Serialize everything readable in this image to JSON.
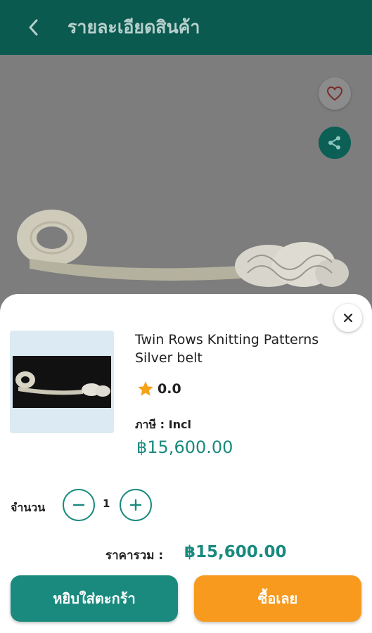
{
  "header": {
    "title": "รายละเอียดสินค้า",
    "back_icon": "chevron-left-icon"
  },
  "product_area": {
    "favorite_icon": "heart-icon",
    "share_icon": "share-icon"
  },
  "sheet": {
    "product_name": "Twin Rows Knitting Patterns Silver belt",
    "rating": "0.0",
    "tax_label": "ภาษี :",
    "tax_value": "Incl",
    "price": "฿15,600.00",
    "quantity_label": "จำนวน",
    "quantity": "1",
    "total_label": "ราคารวม :",
    "total_value": "฿15,600.00",
    "add_to_cart_label": "หยิบใส่ตะกร้า",
    "buy_now_label": "ซื้อเลย"
  },
  "colors": {
    "primary": "#1a8a7e",
    "header": "#0a5a50",
    "accent": "#f79a1e"
  }
}
